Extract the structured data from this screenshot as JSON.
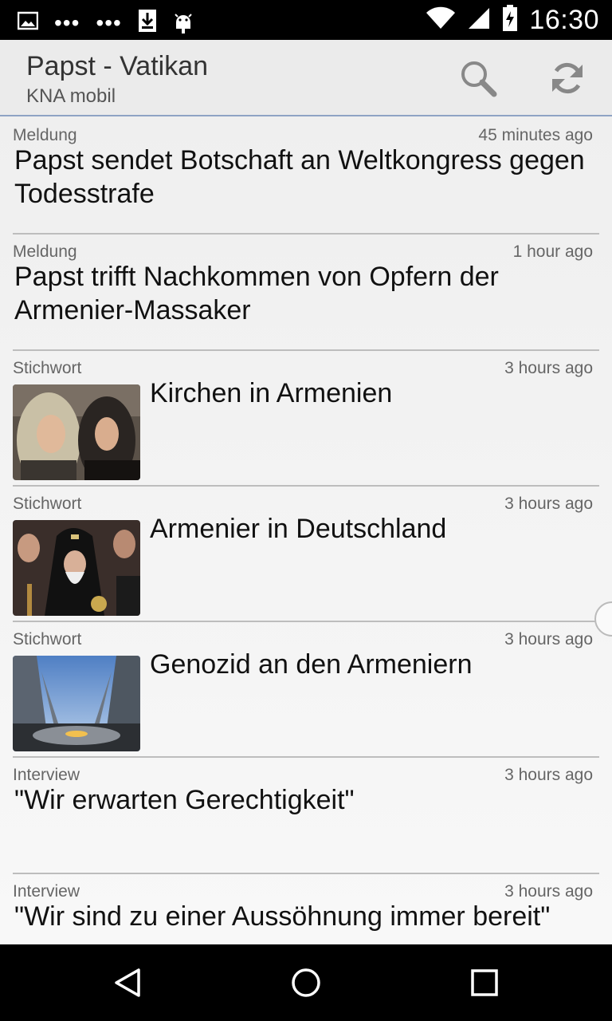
{
  "status_bar": {
    "time": "16:30",
    "left_icons": [
      "image-icon",
      "more-dots-icon",
      "more-dots-icon",
      "download-icon",
      "android-icon"
    ],
    "right_icons": [
      "wifi-icon",
      "signal-icon",
      "battery-charging-icon"
    ]
  },
  "app_bar": {
    "title": "Papst - Vatikan",
    "subtitle": "KNA mobil",
    "actions": [
      "search-icon",
      "refresh-icon"
    ]
  },
  "articles": [
    {
      "category": "Meldung",
      "time": "45 minutes ago",
      "headline": "Papst sendet Botschaft an Weltkongress gegen Todesstrafe",
      "has_image": false
    },
    {
      "category": "Meldung",
      "time": "1 hour ago",
      "headline": "Papst trifft Nachkommen von Opfern der Armenier-Massaker",
      "has_image": false
    },
    {
      "category": "Stichwort",
      "time": "3 hours ago",
      "headline": "Kirchen in Armenien",
      "has_image": true,
      "image": "women-in-headscarves-photo"
    },
    {
      "category": "Stichwort",
      "time": "3 hours ago",
      "headline": "Armenier in Deutschland",
      "has_image": true,
      "image": "clergy-procession-photo"
    },
    {
      "category": "Stichwort",
      "time": "3 hours ago",
      "headline": "Genozid an den Armeniern",
      "has_image": true,
      "image": "memorial-monument-photo"
    },
    {
      "category": "Interview",
      "time": "3 hours ago",
      "headline": "\"Wir erwarten Gerechtigkeit\"",
      "has_image": false
    },
    {
      "category": "Interview",
      "time": "3 hours ago",
      "headline": "\"Wir sind zu einer Aussöhnung immer bereit\"",
      "has_image": false
    }
  ],
  "nav_bar": [
    "back-icon",
    "home-icon",
    "recents-icon"
  ]
}
